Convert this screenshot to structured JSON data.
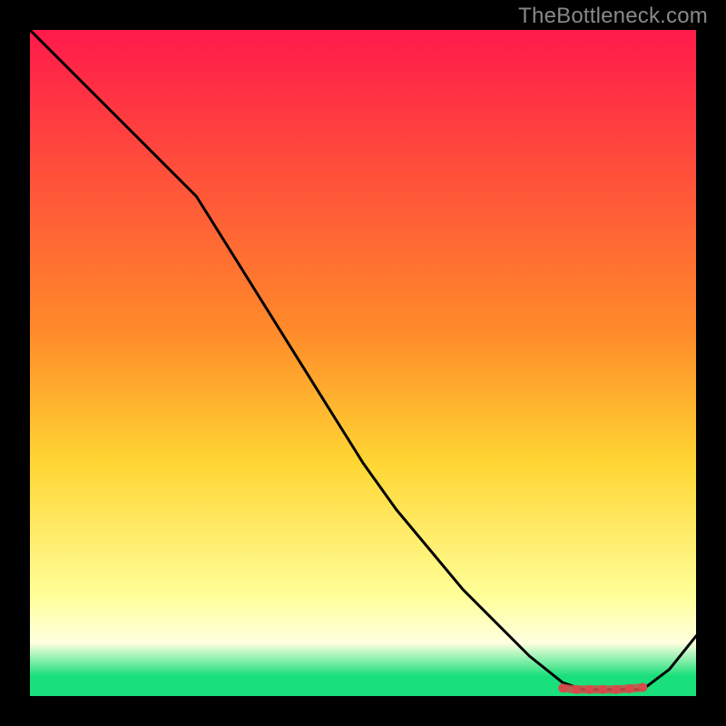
{
  "watermark": "TheBottleneck.com",
  "colors": {
    "bg": "#000000",
    "grad_top": "#ff1a4a",
    "grad_mid1": "#ff8a2a",
    "grad_mid2": "#ffd633",
    "grad_low": "#ffff99",
    "grad_band": "#ffffe0",
    "grad_green": "#19e07a",
    "line": "#000000",
    "marker": "#d64a4a"
  },
  "chart_data": {
    "type": "line",
    "title": "",
    "xlabel": "",
    "ylabel": "",
    "xlim": [
      0,
      100
    ],
    "ylim": [
      0,
      100
    ],
    "series": [
      {
        "name": "curve",
        "x": [
          0,
          5,
          10,
          15,
          20,
          25,
          30,
          35,
          40,
          45,
          50,
          55,
          60,
          65,
          70,
          75,
          80,
          83,
          86,
          89,
          92,
          96,
          100
        ],
        "y": [
          100,
          95,
          90,
          85,
          80,
          75,
          67,
          59,
          51,
          43,
          35,
          28,
          22,
          16,
          11,
          6,
          2,
          1,
          1,
          1,
          1,
          4,
          9
        ]
      }
    ],
    "markers": {
      "name": "optimal-zone",
      "x": [
        80,
        82,
        84,
        86,
        88,
        90,
        92
      ],
      "y": [
        1.2,
        1.0,
        1.0,
        1.0,
        1.0,
        1.1,
        1.3
      ]
    },
    "gradient_stops": [
      {
        "pct": 0,
        "key": "grad_top"
      },
      {
        "pct": 45,
        "key": "grad_mid1"
      },
      {
        "pct": 65,
        "key": "grad_mid2"
      },
      {
        "pct": 85,
        "key": "grad_low"
      },
      {
        "pct": 92,
        "key": "grad_band"
      },
      {
        "pct": 97,
        "key": "grad_green"
      },
      {
        "pct": 100,
        "key": "grad_green"
      }
    ]
  }
}
